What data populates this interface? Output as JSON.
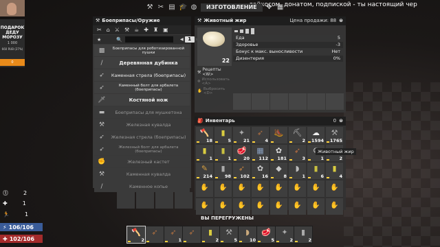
{
  "overlay": {
    "donate_title": "ПОДАРОК ДЕДУ МОРОЗУ",
    "donate_amount": "1 000",
    "donate_sub": "660 RUB (27%)",
    "donate_bar": "0",
    "ticker": "лайкосом, донатом, подпиской - ты настоящий чер"
  },
  "topbar": {
    "title": "ИЗГОТОВЛЕНИЕ"
  },
  "ammo_panel": {
    "title": "Боеприпасы/Оружие",
    "page": "1",
    "recipes": [
      {
        "name": "Боеприпасы для роботизированной пушки",
        "style": "small",
        "dim": false
      },
      {
        "name": "Деревянная дубинка",
        "style": "big",
        "dim": false
      },
      {
        "name": "Каменная стрела (боеприпасы)",
        "style": "med",
        "dim": false
      },
      {
        "name": "Каменный болт для арбалета (боеприпасы)",
        "style": "small",
        "dim": false
      },
      {
        "name": "Костяной нож",
        "style": "big",
        "dim": false
      },
      {
        "name": "Боеприпасы для мушкетона",
        "style": "med",
        "dim": true
      },
      {
        "name": "Железная кувалда",
        "style": "med",
        "dim": true
      },
      {
        "name": "Железная стрела (боеприпасы)",
        "style": "med",
        "dim": true
      },
      {
        "name": "Железный болт для арбалета (боеприпасы)",
        "style": "small",
        "dim": true
      },
      {
        "name": "Железный кастет",
        "style": "med",
        "dim": true
      },
      {
        "name": "Каменная кувалда",
        "style": "med",
        "dim": true
      },
      {
        "name": "Каменное копье",
        "style": "med",
        "dim": true
      }
    ]
  },
  "detail": {
    "title": "Животный жир",
    "price_label": "Цена продажи: 88",
    "qty": "22",
    "stats": [
      {
        "label": "Еда",
        "value": "5"
      },
      {
        "label": "Здоровье",
        "value": "-3"
      },
      {
        "label": "Бонус к макс. выносливости",
        "value": "Нет"
      },
      {
        "label": "Дизентерия",
        "value": "0%"
      }
    ],
    "recipes_label": "Рецепты <W>",
    "use_label": "Использовать <A>",
    "drop_label": "Выбросить <D>"
  },
  "inventory": {
    "title": "Инвентарь",
    "count": "0",
    "tooltip": "Животный жир",
    "overload": "ВЫ ПЕРЕГРУЖЕНЫ",
    "slots": [
      {
        "icon": "🪓",
        "color": "#c9a97c",
        "count": "18"
      },
      {
        "icon": "▮",
        "color": "#d9cc40",
        "count": "5"
      },
      {
        "icon": "✦",
        "color": "#aaa",
        "count": "21"
      },
      {
        "icon": "➶",
        "color": "#b07040",
        "count": "4"
      },
      {
        "icon": "🥾",
        "color": "#c9a040",
        "count": ""
      },
      {
        "icon": "⛏",
        "color": "#bbb",
        "count": "2"
      },
      {
        "icon": "☁",
        "color": "#eee",
        "count": "1594"
      },
      {
        "icon": "⚒",
        "color": "#aaa",
        "count": "1765"
      },
      {
        "icon": "▮",
        "color": "#d9cc40",
        "count": "1"
      },
      {
        "icon": "▮",
        "color": "#c9c040",
        "count": "1"
      },
      {
        "icon": "🥩",
        "color": "#d34a4a",
        "count": "20"
      },
      {
        "icon": "▦",
        "color": "#8aa0c0",
        "count": "112"
      },
      {
        "icon": "✿",
        "color": "#ddd",
        "count": "181"
      },
      {
        "icon": "➶",
        "color": "#c07040",
        "count": "3"
      },
      {
        "icon": "⚙",
        "color": "#bbb",
        "count": "1"
      },
      {
        "icon": "▲",
        "color": "#c9a97c",
        "count": "2"
      },
      {
        "icon": "✎",
        "color": "#d8a040",
        "count": "214"
      },
      {
        "icon": "▮",
        "color": "#aaa",
        "count": "98"
      },
      {
        "icon": "➶",
        "color": "#c08040",
        "count": "102"
      },
      {
        "icon": "✿",
        "color": "#ccc",
        "count": "16"
      },
      {
        "icon": "◆",
        "color": "#ccc",
        "count": "8"
      },
      {
        "icon": "◗",
        "color": "#bbb",
        "count": "1"
      },
      {
        "icon": "▮",
        "color": "#c9c040",
        "count": "6"
      },
      {
        "icon": "▮",
        "color": "#d9cc40",
        "count": "4"
      }
    ],
    "empty_slots": 16
  },
  "belt": [
    {
      "icon": "🪓",
      "color": "#c9a97c",
      "count": "2"
    },
    {
      "icon": "➶",
      "color": "#b07040",
      "count": ""
    },
    {
      "icon": "➶",
      "color": "#b07040",
      "count": "1"
    },
    {
      "icon": "➶",
      "color": "#b07040",
      "count": ""
    },
    {
      "icon": "▮",
      "color": "#d9cc40",
      "count": "2"
    },
    {
      "icon": "⚒",
      "color": "#aaa",
      "count": "5"
    },
    {
      "icon": "◗",
      "color": "#c9a97c",
      "count": "10"
    },
    {
      "icon": "🥩",
      "color": "#d34a4a",
      "count": "5"
    },
    {
      "icon": "✦",
      "color": "#aaa",
      "count": "2"
    },
    {
      "icon": "▮",
      "color": "#aaa",
      "count": "2"
    }
  ],
  "status": {
    "level": "2",
    "heal": "1",
    "xp": "1",
    "stamina": "106/106",
    "health": "102/106"
  },
  "colors": {
    "stamina": "#3a5c99",
    "health": "#a32b2b",
    "donate_bar": "#e88a1a"
  }
}
